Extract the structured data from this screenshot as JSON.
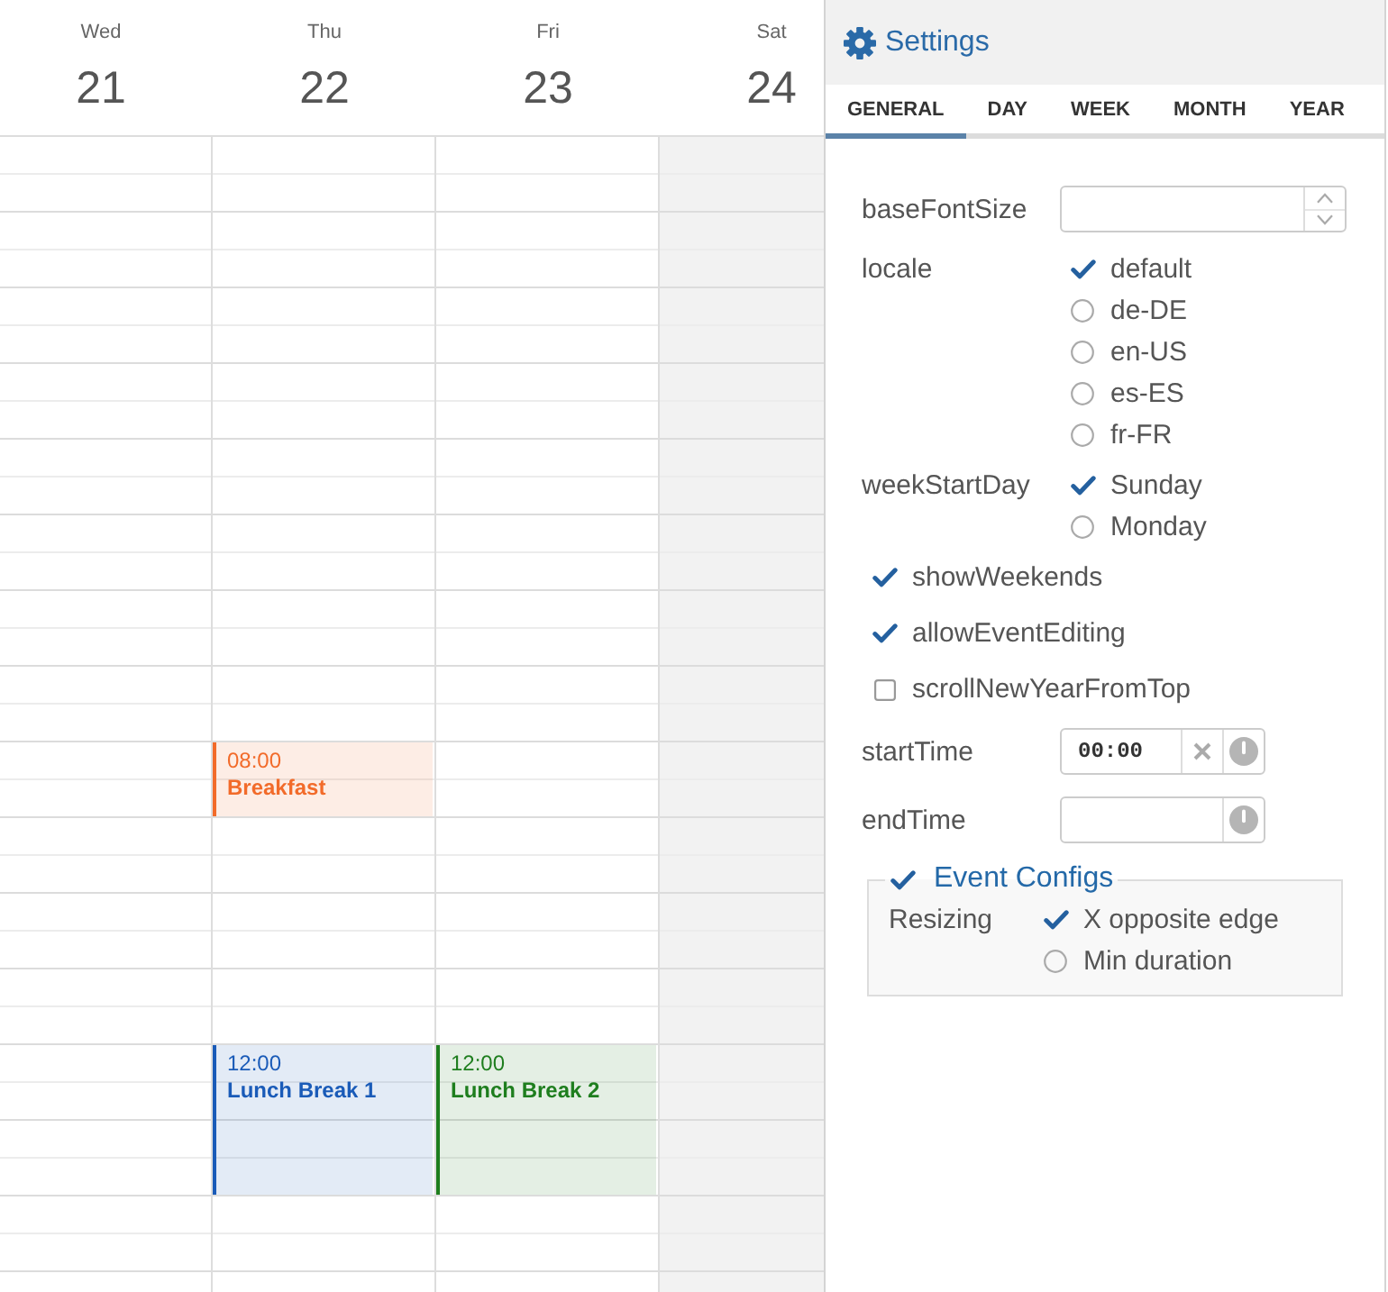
{
  "calendar": {
    "days": [
      {
        "weekday": "Wed",
        "date": "21",
        "weekend": false
      },
      {
        "weekday": "Thu",
        "date": "22",
        "weekend": false,
        "events": [
          {
            "kind": "short",
            "time": "08:00",
            "title": "Breakfast",
            "color": "#f26b2a"
          },
          {
            "kind": "long",
            "time": "12:00",
            "title": "Lunch Break 1",
            "color": "#1a5bb8"
          }
        ]
      },
      {
        "weekday": "Fri",
        "date": "23",
        "weekend": false,
        "events": [
          {
            "kind": "long",
            "time": "12:00",
            "title": "Lunch Break 2",
            "color": "#1e7e1e"
          }
        ]
      },
      {
        "weekday": "Sat",
        "date": "24",
        "weekend": true
      }
    ]
  },
  "settings": {
    "title": "Settings",
    "tabs": [
      {
        "label": "GENERAL",
        "selected": true
      },
      {
        "label": "DAY",
        "selected": false
      },
      {
        "label": "WEEK",
        "selected": false
      },
      {
        "label": "MONTH",
        "selected": false
      },
      {
        "label": "YEAR",
        "selected": false
      }
    ],
    "fields": [
      {
        "kind": "number",
        "label": "baseFontSize"
      },
      {
        "kind": "radio",
        "label": "locale",
        "options": [
          {
            "label": "default",
            "selected": true
          },
          {
            "label": "de-DE",
            "selected": false
          },
          {
            "label": "en-US",
            "selected": false
          },
          {
            "label": "es-ES",
            "selected": false
          },
          {
            "label": "fr-FR",
            "selected": false
          }
        ]
      },
      {
        "kind": "radio",
        "label": "weekStartDay",
        "options": [
          {
            "label": "Sunday",
            "selected": true
          },
          {
            "label": "Monday",
            "selected": false
          }
        ]
      },
      {
        "kind": "checkbox",
        "label": "showWeekends",
        "checked": true
      },
      {
        "kind": "checkbox",
        "label": "allowEventEditing",
        "checked": true
      },
      {
        "kind": "checkbox",
        "label": "scrollNewYearFromTop",
        "checked": false
      },
      {
        "kind": "time",
        "label": "startTime",
        "value": "00:00"
      },
      {
        "kind": "time",
        "label": "endTime"
      },
      {
        "kind": "fieldset",
        "legend": "Event Configs",
        "checked": true,
        "fields": [
          {
            "kind": "radio",
            "label": "Resizing",
            "options": [
              {
                "label": "X opposite edge",
                "selected": true
              },
              {
                "label": "Min duration",
                "selected": false
              }
            ]
          }
        ]
      }
    ]
  }
}
